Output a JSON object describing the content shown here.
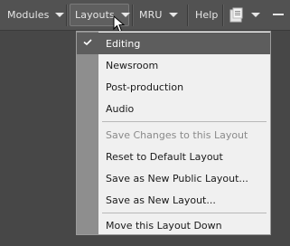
{
  "toolbar": {
    "modules_label": "Modules",
    "layouts_label": "Layouts",
    "mru_label": "MRU",
    "help_label": "Help"
  },
  "layouts_menu": {
    "layouts": [
      {
        "label": "Editing",
        "checked": true
      },
      {
        "label": "Newsroom",
        "checked": false
      },
      {
        "label": "Post-production",
        "checked": false
      },
      {
        "label": "Audio",
        "checked": false
      }
    ],
    "actions": [
      {
        "label": "Save Changes to this Layout",
        "enabled": false
      },
      {
        "label": "Reset to Default Layout",
        "enabled": true
      },
      {
        "label": "Save as New Public Layout...",
        "enabled": true
      },
      {
        "label": "Save as New Layout...",
        "enabled": true
      }
    ],
    "move_label": "Move this Layout Down"
  },
  "colors": {
    "background": "#474747",
    "toolbar": "#525252",
    "menu_bg": "#f0f0f0",
    "menu_gutter": "#8e8e8e",
    "selected_item": "#5d5d5d"
  },
  "icons": [
    "chevron-down-icon",
    "document-icon",
    "minimize-icon",
    "check-icon",
    "mouse-cursor-icon"
  ]
}
